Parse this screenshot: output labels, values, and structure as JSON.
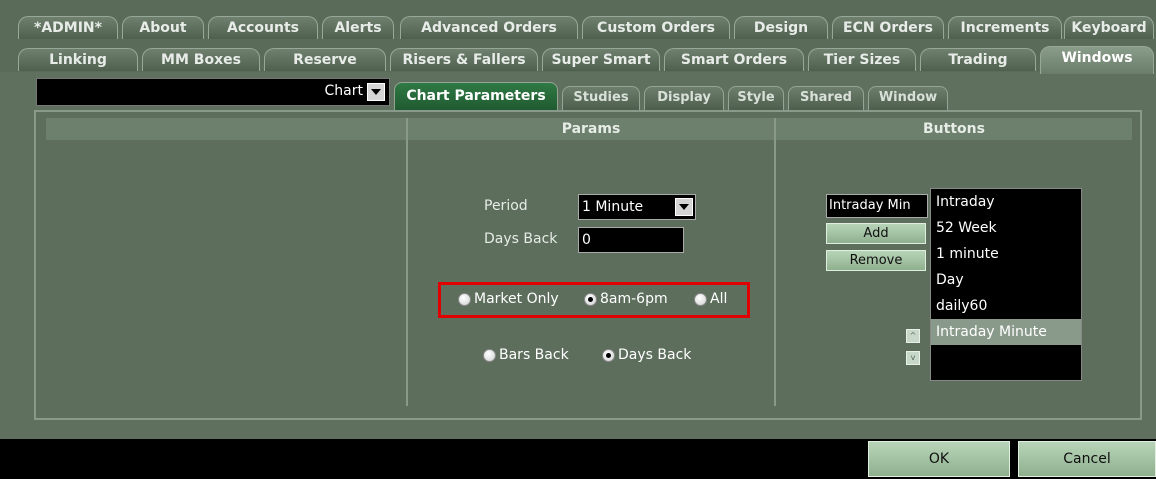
{
  "tabs_row1": [
    "*ADMIN*",
    "About",
    "Accounts",
    "Alerts",
    "Advanced Orders",
    "Custom Orders",
    "Design",
    "ECN Orders",
    "Increments",
    "Keyboard"
  ],
  "tabs_row2": [
    "Linking",
    "MM Boxes",
    "Reserve",
    "Risers & Fallers",
    "Super Smart",
    "Smart Orders",
    "Tier Sizes",
    "Trading",
    "Windows"
  ],
  "active_main_tab": "Windows",
  "window_selector": {
    "value": "Chart"
  },
  "subtabs": [
    "Chart Parameters",
    "Studies",
    "Display",
    "Style",
    "Shared",
    "Window"
  ],
  "active_subtab": "Chart Parameters",
  "columns": {
    "params_header": "Params",
    "buttons_header": "Buttons"
  },
  "params": {
    "period_label": "Period",
    "period_value": "1 Minute",
    "days_back_label": "Days Back",
    "days_back_value": "0",
    "session_options": [
      "Market Only",
      "8am-6pm",
      "All"
    ],
    "session_selected": "8am-6pm",
    "range_options": [
      "Bars Back",
      "Days Back"
    ],
    "range_selected": "Days Back"
  },
  "buttons_panel": {
    "name_value": "Intraday Min",
    "add_label": "Add",
    "remove_label": "Remove",
    "list": [
      "Intraday",
      "52 Week",
      "1 minute",
      "Day",
      "daily60",
      "Intraday Minute"
    ],
    "selected": "Intraday Minute",
    "up_glyph": "^",
    "down_glyph": "v"
  },
  "footer": {
    "ok_label": "OK",
    "cancel_label": "Cancel"
  },
  "colors": {
    "highlight": "#e00000",
    "active_subtab": "#2f7a45",
    "panel": "#5a6b5a"
  }
}
